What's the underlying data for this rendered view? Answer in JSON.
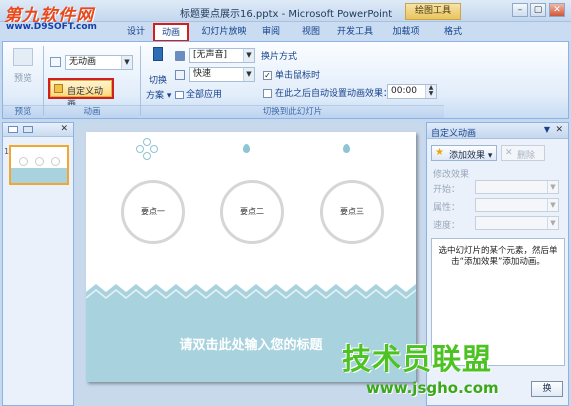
{
  "watermark_top": {
    "logo": "第九软件网",
    "url": "www.D9SOFT.com"
  },
  "window": {
    "title": "标题要点展示16.pptx - Microsoft PowerPoint",
    "contextual_tab": "绘图工具",
    "controls": {
      "minimize": "–",
      "restore": "▢",
      "close": "✕"
    }
  },
  "ribbon_tabs": [
    {
      "label": "设计",
      "active": false
    },
    {
      "label": "动画",
      "active": true
    },
    {
      "label": "幻灯片放映",
      "active": false
    },
    {
      "label": "审阅",
      "active": false
    },
    {
      "label": "视图",
      "active": false
    },
    {
      "label": "开发工具",
      "active": false
    },
    {
      "label": "加载项",
      "active": false
    },
    {
      "label": "格式",
      "active": false
    }
  ],
  "ribbon": {
    "preview_group": {
      "button": "预览",
      "label": "预览"
    },
    "animation_group": {
      "animate_label": "动画：",
      "animate_value": "无动画",
      "custom_animation_button": "自定义动画",
      "label": "动画"
    },
    "transition_group": {
      "transition_scheme_label_line1": "切换",
      "transition_scheme_label_line2": "方案 ▾",
      "sound_value": "[无声音]",
      "speed_value": "快速",
      "apply_all": "全部应用",
      "advance_title": "换片方式",
      "on_click_label": "单击鼠标时",
      "on_click_checked": true,
      "after_label": "在此之后自动设置动画效果：",
      "after_checked": false,
      "after_value": "00:00",
      "label": "切换到此幻灯片"
    }
  },
  "left_panel": {
    "slide_number": "1",
    "close": "✕"
  },
  "slide": {
    "points": [
      "要点一",
      "要点二",
      "要点三"
    ],
    "title_placeholder": "请双击此处输入您的标题",
    "colors": {
      "teal": "#a8d3de",
      "teal_dark": "#7fbccb",
      "circle_border": "#d6d6d6"
    }
  },
  "task_pane": {
    "title": "自定义动画",
    "add_effect": "添加效果 ▾",
    "remove": "删除",
    "modify_header": "修改效果",
    "start_label": "开始：",
    "property_label": "属性：",
    "speed_label": "速度：",
    "info": "选中幻灯片的某个元素，然后单击“添加效果”添加动画。",
    "bottom_button": "换"
  },
  "watermark_bottom": {
    "brand": "技术员联盟",
    "url": "www.jsgho.com"
  }
}
